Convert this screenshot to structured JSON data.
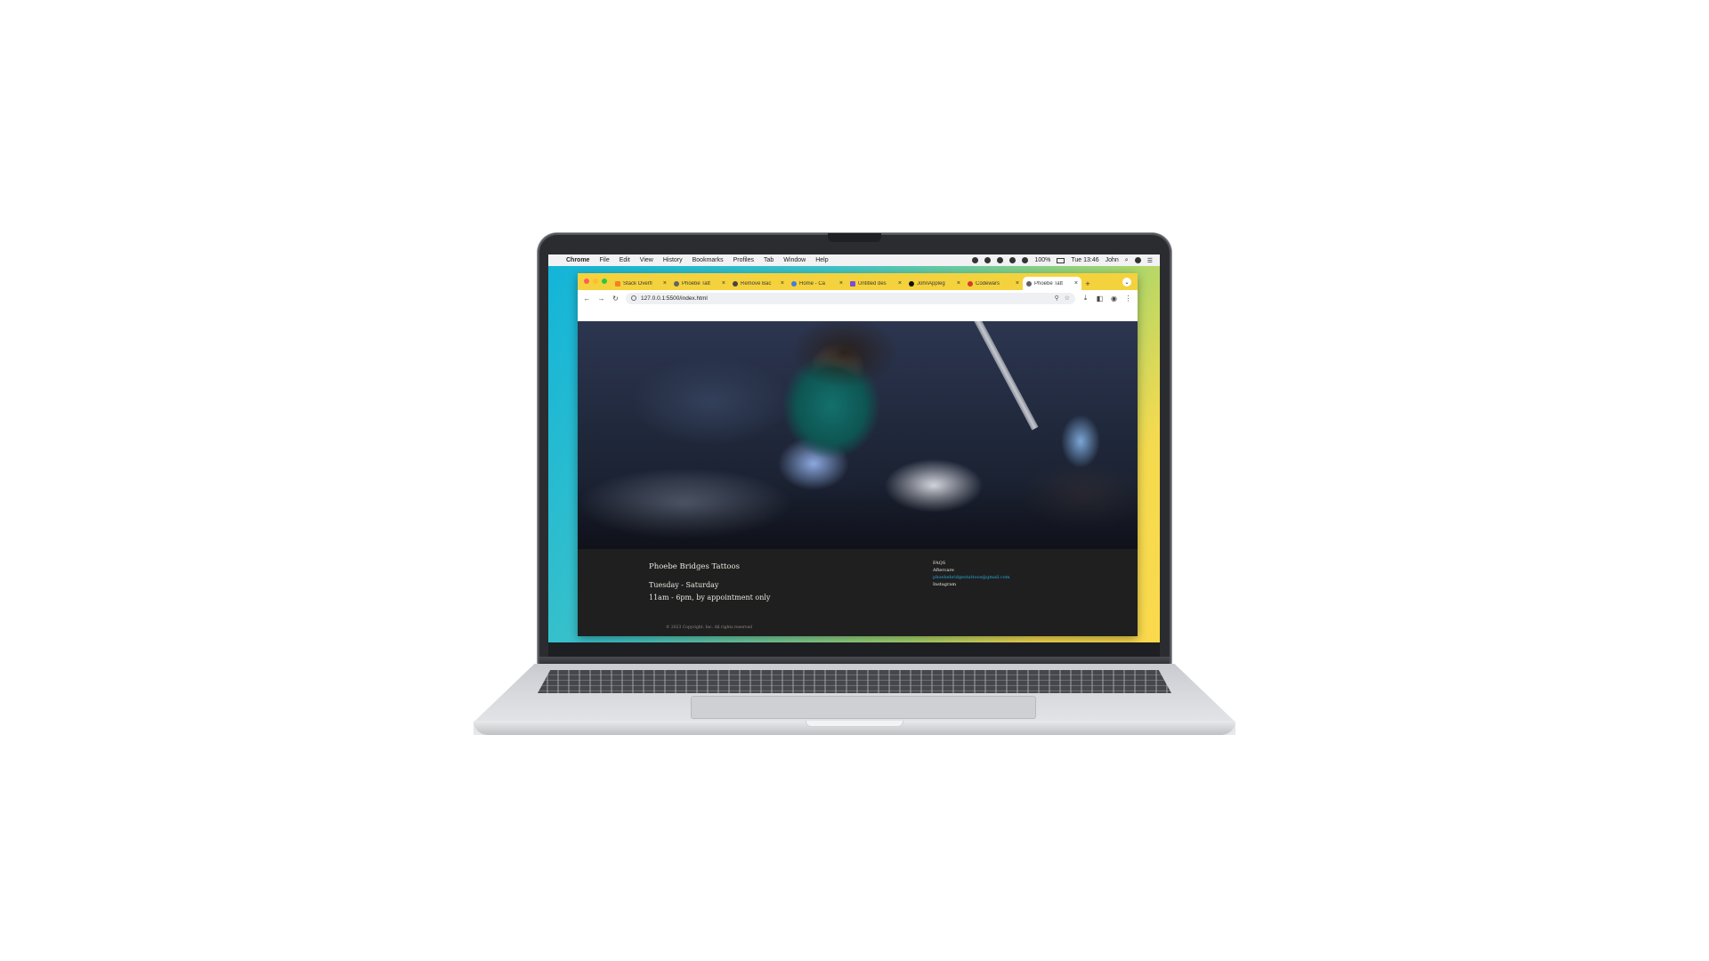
{
  "menubar": {
    "apple": "",
    "app": "Chrome",
    "items": [
      "File",
      "Edit",
      "View",
      "History",
      "Bookmarks",
      "Profiles",
      "Tab",
      "Window",
      "Help"
    ],
    "battery": "100%",
    "clock": "Tue 13:46",
    "user": "John"
  },
  "tabs": [
    {
      "label": "Stack Overfl",
      "icon": "stackoverflow-icon"
    },
    {
      "label": "Phoebe Tatt",
      "icon": "globe-icon"
    },
    {
      "label": "Remove Bac",
      "icon": "eye-icon"
    },
    {
      "label": "Home - Ca",
      "icon": "globe-icon"
    },
    {
      "label": "Untitled des",
      "icon": "canva-icon"
    },
    {
      "label": "JohnAppleg",
      "icon": "github-icon"
    },
    {
      "label": "Codewars",
      "icon": "codewars-icon"
    },
    {
      "label": "Phoebe Tatt",
      "icon": "globe-icon",
      "active": true
    }
  ],
  "toolbar": {
    "url": "127.0.0.1:5500/index.html"
  },
  "footer": {
    "brand": "Phoebe Bridges Tattoos",
    "days": "Tuesday - Saturday",
    "hours": "11am - 6pm, by appointment only",
    "links": {
      "faqs": "FAQS",
      "aftercare": "Aftercare",
      "email": "phoebebridgestattoos@gmail.com",
      "instagram": "Instagram"
    },
    "copyright": "© 2023 Copyright. Inc. All rights reserved"
  },
  "colors": {
    "tabstrip": "#f4d23d",
    "page_bg": "#1f1f20",
    "link_accent": "#28a7d8",
    "desktop_gradient_start": "#12b4d9",
    "desktop_gradient_end": "#fbd94c"
  }
}
